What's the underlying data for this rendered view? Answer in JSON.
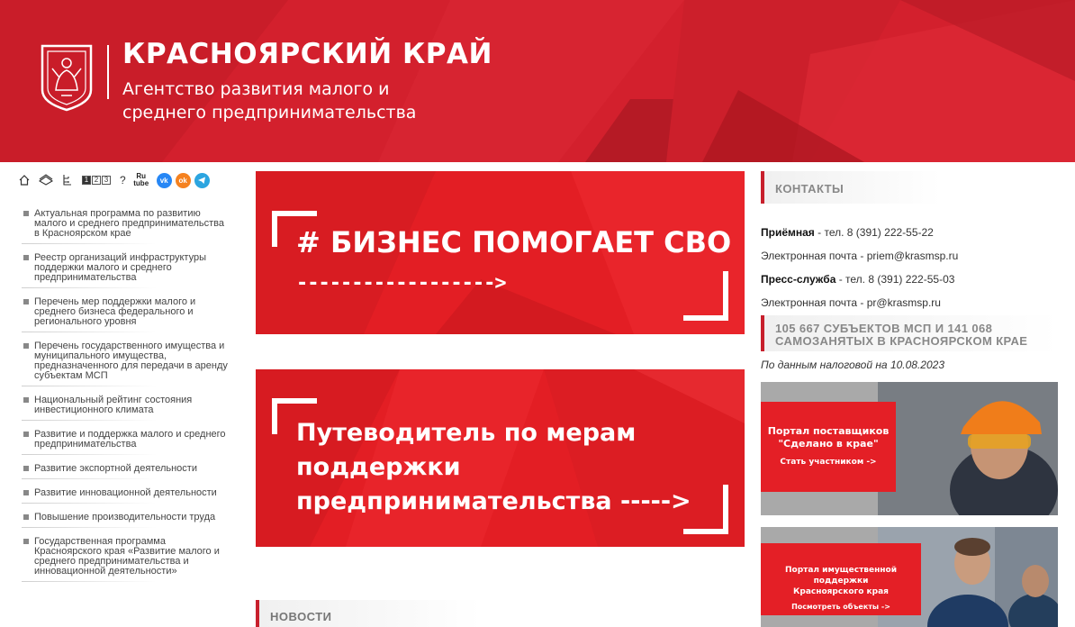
{
  "header": {
    "title": "КРАСНОЯРСКИЙ КРАЙ",
    "subtitle": "Агентство развития малого и\nсреднего предпринимательства",
    "colors": {
      "brand_red": "#d3202d",
      "accent": "#e31e24"
    }
  },
  "toolbar": {
    "icons": [
      "home-icon",
      "map-icon",
      "sitemap-icon",
      "font-size-icon",
      "help-icon",
      "rutube-icon",
      "vk-icon",
      "ok-icon",
      "telegram-icon"
    ],
    "numbers": [
      "1",
      "2",
      "3"
    ],
    "help": "?",
    "rutube": "Ru\ntube",
    "vk": "vk",
    "ok": "ok"
  },
  "sidebar": {
    "items": [
      {
        "label": "Актуальная программа по развитию малого и среднего предпринимательства в Красноярском крае"
      },
      {
        "label": "Реестр организаций инфраструктуры поддержки малого и среднего предпринимательства"
      },
      {
        "label": "Перечень мер поддержки малого и среднего бизнеса федерального и регионального уровня"
      },
      {
        "label": "Перечень государственного имущества и муниципального имущества, предназначенного для передачи в аренду субъектам МСП"
      },
      {
        "label": "Национальный рейтинг состояния инвестиционного климата"
      },
      {
        "label": "Развитие и поддержка малого и среднего предпринимательства"
      },
      {
        "label": "Развитие экспортной деятельности"
      },
      {
        "label": "Развитие инновационной деятельности"
      },
      {
        "label": "Повышение производительности труда"
      },
      {
        "label": "Государственная программа Красноярского края «Развитие малого и среднего предпринимательства и инновационной деятельности»"
      }
    ]
  },
  "main": {
    "banner1": {
      "title": "# БИЗНЕС ПОМОГАЕТ СВО",
      "arrow": "------------------>"
    },
    "banner2": {
      "title": "Путеводитель по мерам\nподдержки\nпредпринимательства ----->"
    },
    "news_heading": "НОВОСТИ"
  },
  "contacts": {
    "heading": "КОНТАКТЫ",
    "reception_label": "Приёмная",
    "reception_phone": " - тел. 8 (391) 222-55-22",
    "reception_email": "Электронная почта - priem@krasmsp.ru",
    "press_label": "Пресс-служба",
    "press_phone": " - тел. 8 (391) 222-55-03",
    "press_email": "Электронная почта - pr@krasmsp.ru"
  },
  "stats": {
    "heading": "105 667 СУБЪЕКТОВ МСП И 141 068 САМОЗАНЯТЫХ В КРАСНОЯРСКОМ КРАЕ",
    "note": "По данным налоговой на 10.08.2023"
  },
  "promos": [
    {
      "title_line1": "Портал поставщиков",
      "title_line2": "\"Сделано в крае\"",
      "cta": "Стать участником ->"
    },
    {
      "title_line1": "Портал имущественной поддержки",
      "title_line2": "Красноярского края",
      "cta": "Посмотреть объекты ->"
    }
  ]
}
